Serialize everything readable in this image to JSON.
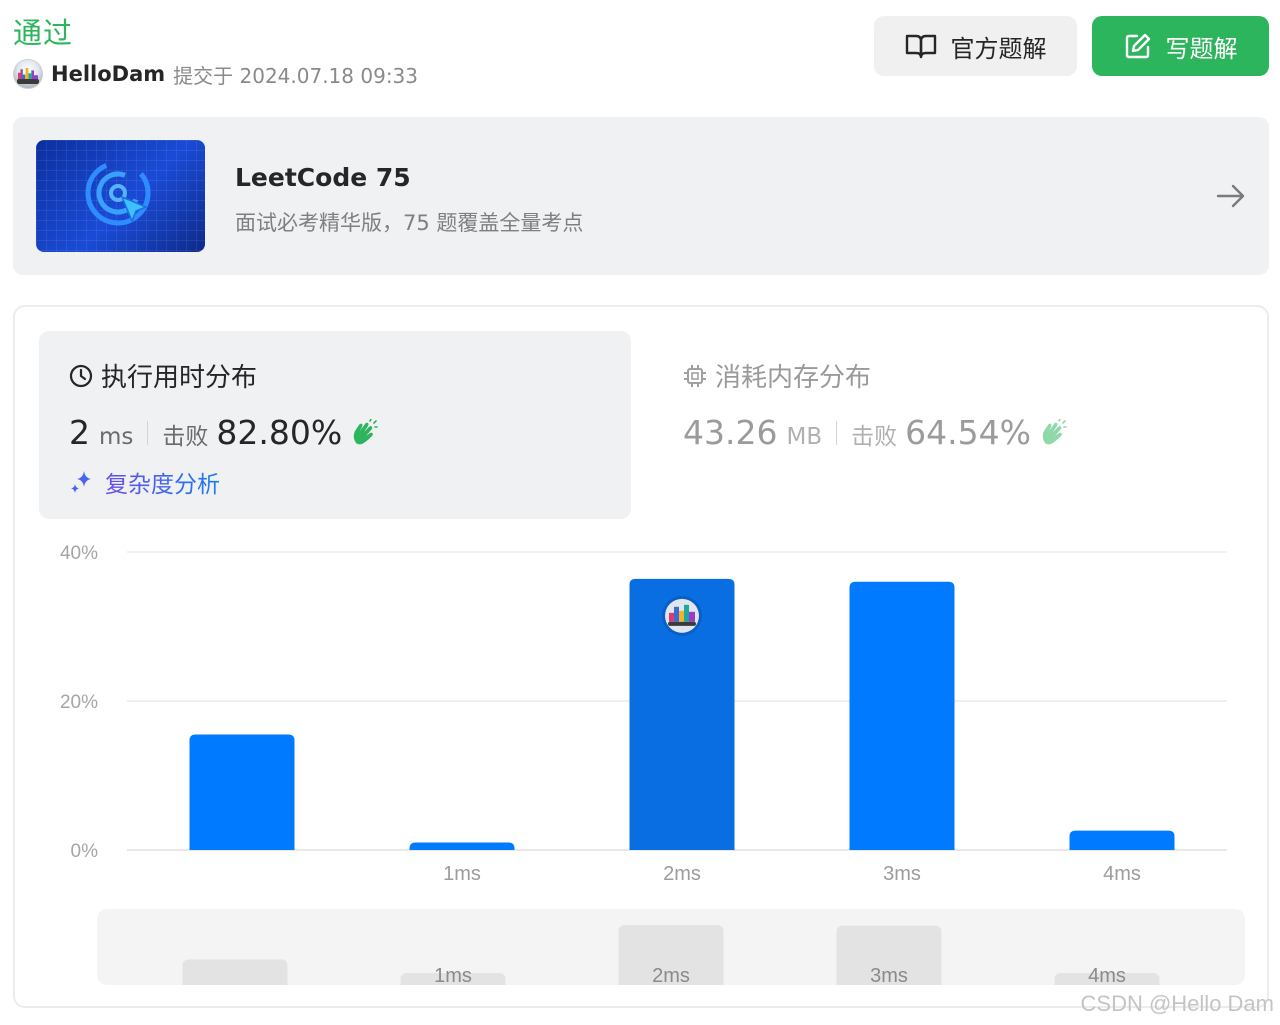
{
  "header": {
    "status": "通过",
    "username": "HelloDam",
    "submitted_text": "提交于 2024.07.18 09:33",
    "official_solution_label": "官方题解",
    "write_solution_label": "写题解"
  },
  "study_plan": {
    "title": "LeetCode 75",
    "subtitle": "面试必考精华版，75 题覆盖全量考点"
  },
  "runtime": {
    "heading": "执行用时分布",
    "value": "2",
    "unit": "ms",
    "beat_label": "击败",
    "beat_value": "82.80%",
    "complexity_label": "复杂度分析"
  },
  "memory": {
    "heading": "消耗内存分布",
    "value": "43.26",
    "unit": "MB",
    "beat_label": "击败",
    "beat_value": "64.54%"
  },
  "colors": {
    "accent_green": "#2db55d",
    "bar_blue": "#007aff",
    "bar_selected": "#0a6ee3",
    "overview_bar": "#e3e3e3"
  },
  "chart_data": {
    "type": "bar",
    "categories": [
      "",
      "1ms",
      "2ms",
      "3ms",
      "4ms"
    ],
    "values": [
      15.5,
      1.0,
      36.4,
      36.0,
      2.6
    ],
    "selected_index": 2,
    "y_ticks": [
      "0%",
      "20%",
      "40%"
    ],
    "ylim": [
      0,
      40
    ],
    "grid": true,
    "overview": {
      "categories": [
        "",
        "1ms",
        "2ms",
        "3ms",
        "4ms"
      ],
      "values": [
        15.5,
        1.0,
        36.4,
        36.0,
        2.6
      ]
    }
  },
  "watermark": "CSDN @Hello Dam"
}
